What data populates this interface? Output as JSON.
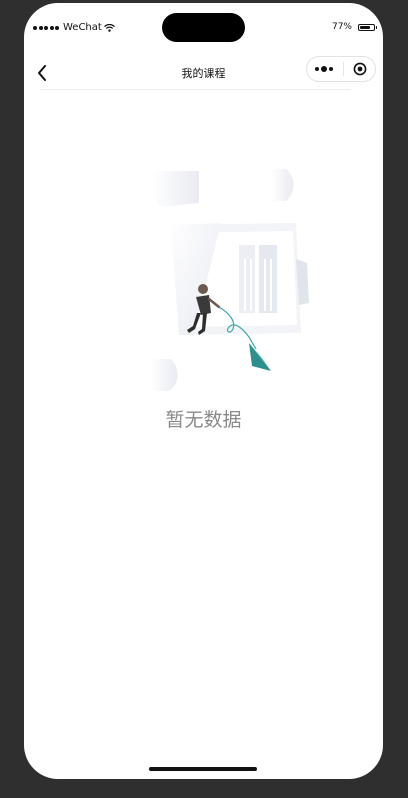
{
  "status_bar": {
    "carrier": "WeChat",
    "battery_text": "77%",
    "battery_level": 0.77
  },
  "nav": {
    "title": "我的课程",
    "back_icon": "chevron-left-icon",
    "more_icon": "more-dots-icon",
    "close_icon": "target-circle-icon"
  },
  "empty_state": {
    "message": "暂无数据",
    "illustration": "person-pulling-paper-plane-illustration"
  },
  "colors": {
    "accent_teal": "#3ea6a6",
    "text_muted": "#8a8a8a"
  }
}
